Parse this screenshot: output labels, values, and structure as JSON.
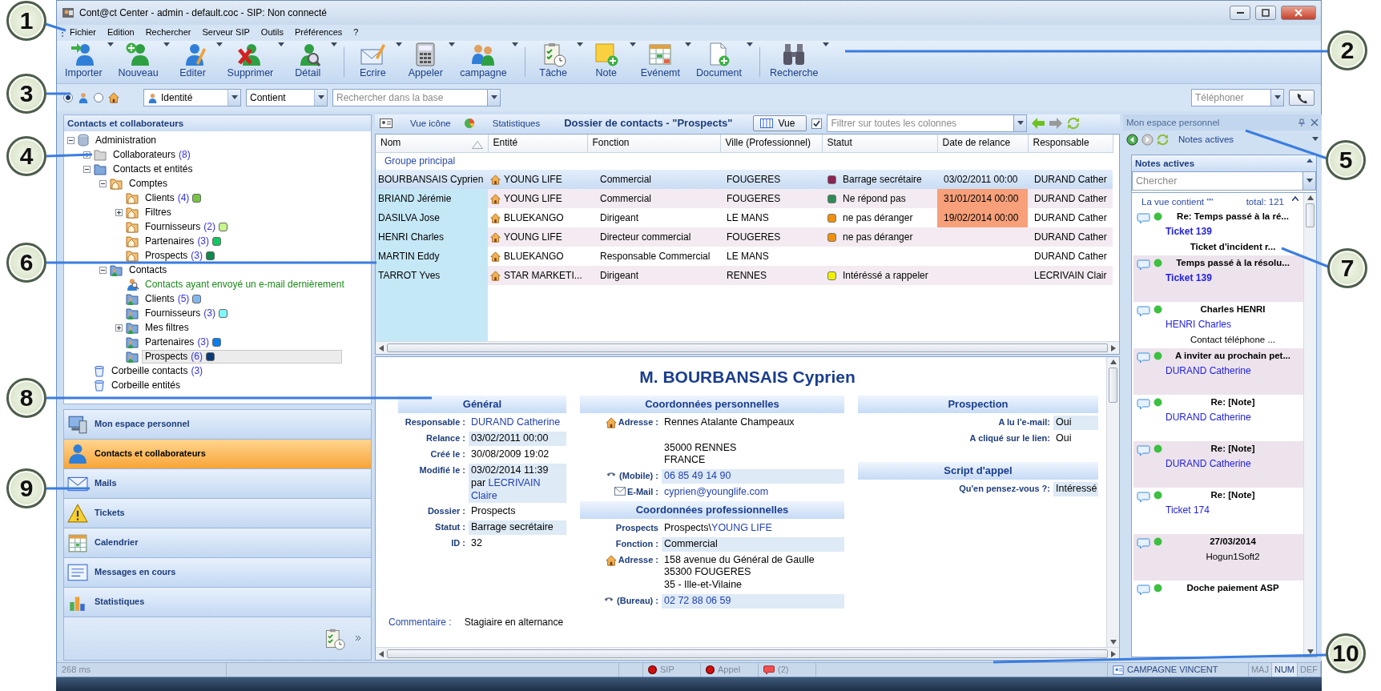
{
  "window": {
    "title": "Cont@ct Center - admin - default.coc - SIP: Non connecté"
  },
  "menu": [
    "Fichier",
    "Edition",
    "Rechercher",
    "Serveur SIP",
    "Outils",
    "Préférences",
    "?"
  ],
  "toolbar": [
    {
      "kind": "button",
      "label": "Importer"
    },
    {
      "kind": "button",
      "label": "Nouveau"
    },
    {
      "kind": "button",
      "label": "Editer"
    },
    {
      "kind": "button",
      "label": "Supprimer"
    },
    {
      "kind": "button",
      "label": "Détail"
    },
    {
      "kind": "separator"
    },
    {
      "kind": "button",
      "label": "Ecrire"
    },
    {
      "kind": "button",
      "label": "Appeler"
    },
    {
      "kind": "button",
      "label": "campagne"
    },
    {
      "kind": "separator"
    },
    {
      "kind": "button",
      "label": "Tâche"
    },
    {
      "kind": "button",
      "label": "Note"
    },
    {
      "kind": "button",
      "label": "Evénemt"
    },
    {
      "kind": "button",
      "label": "Document"
    },
    {
      "kind": "separator"
    },
    {
      "kind": "button",
      "label": "Recherche"
    }
  ],
  "search_bar": {
    "modes": [
      {
        "selected": true
      },
      {
        "selected": false
      }
    ],
    "field": "Identité",
    "operator": "Contient",
    "query": {
      "placeholder": "Rechercher dans la base"
    },
    "phone": {
      "placeholder": "Téléphoner"
    }
  },
  "left_panel": {
    "title": "Contacts et collaborateurs",
    "tree": [
      {
        "label": "Administration",
        "kind": "database",
        "expanded": true,
        "selected": false,
        "children": [
          {
            "label": "Collaborateurs",
            "count": "(8)",
            "kind": "grey-folder",
            "expanded": false,
            "selected": false
          },
          {
            "label": "Contacts et entités",
            "kind": "blue-folder",
            "expanded": true,
            "selected": false,
            "children": [
              {
                "label": "Comptes",
                "kind": "account-folder",
                "expanded": true,
                "selected": false,
                "children": [
                  {
                    "label": "Clients",
                    "count": "(4)",
                    "color": "#76c442",
                    "kind": "account-folder",
                    "selected": false
                  },
                  {
                    "label": "Filtres",
                    "kind": "account-folder",
                    "expanded": false,
                    "selected": false
                  },
                  {
                    "label": "Fournisseurs",
                    "count": "(2)",
                    "color": "#c8f58c",
                    "kind": "account-folder",
                    "selected": false
                  },
                  {
                    "label": "Partenaires",
                    "count": "(3)",
                    "color": "#10c860",
                    "kind": "account-folder",
                    "selected": false
                  },
                  {
                    "label": "Prospects",
                    "count": "(3)",
                    "color": "#0e8a4a",
                    "kind": "account-folder",
                    "selected": false
                  }
                ]
              },
              {
                "label": "Contacts",
                "kind": "contact-folder",
                "expanded": true,
                "selected": false,
                "children": [
                  {
                    "label": "Contacts ayant envoyé un e-mail dernièrement",
                    "kind": "search",
                    "selected": false
                  },
                  {
                    "label": "Clients",
                    "count": "(5)",
                    "color": "#80b8f0",
                    "kind": "contact-folder",
                    "selected": false
                  },
                  {
                    "label": "Fournisseurs",
                    "count": "(3)",
                    "color": "#80f8f8",
                    "kind": "contact-folder",
                    "selected": false
                  },
                  {
                    "label": "Mes filtres",
                    "kind": "contact-folder",
                    "expanded": false,
                    "selected": false
                  },
                  {
                    "label": "Partenaires",
                    "count": "(3)",
                    "color": "#0a80f0",
                    "kind": "contact-folder",
                    "selected": false
                  },
                  {
                    "label": "Prospects",
                    "count": "(6)",
                    "color": "#0a3a78",
                    "kind": "contact-folder",
                    "selected": true
                  }
                ]
              }
            ]
          },
          {
            "label": "Corbeille contacts",
            "count": "(3)",
            "kind": "bin",
            "selected": false
          },
          {
            "label": "Corbeille entités",
            "kind": "bin",
            "selected": false
          }
        ]
      }
    ]
  },
  "nav": [
    {
      "label": "Mon espace personnel",
      "selected": false
    },
    {
      "label": "Contacts et collaborateurs",
      "selected": true
    },
    {
      "label": "Mails",
      "selected": false
    },
    {
      "label": "Tickets",
      "selected": false
    },
    {
      "label": "Calendrier",
      "selected": false
    },
    {
      "label": "Messages en cours",
      "selected": false
    },
    {
      "label": "Statistiques",
      "selected": false
    }
  ],
  "center": {
    "header": {
      "icon_view": "Vue icône",
      "stats": "Statistiques",
      "title": "Dossier de contacts - \"Prospects\"",
      "view_button": "Vue",
      "filter": {
        "checked": true,
        "placeholder": "Filtrer sur toutes les colonnes"
      }
    },
    "table": {
      "columns": [
        "Nom",
        "Entité",
        "Fonction",
        "Ville (Professionnel)",
        "Statut",
        "Date de relance",
        "Responsable"
      ],
      "group": "Groupe principal",
      "rows": [
        {
          "nom": "BOURBANSAIS Cyprien",
          "entite": "YOUNG LIFE",
          "fonction": "Commercial",
          "ville": "FOUGERES",
          "statut": {
            "text": "Barrage secrétaire",
            "color": "#8b2252"
          },
          "relance": {
            "text": "03/02/2011 00:00",
            "overdue": false
          },
          "responsable": "DURAND Cather",
          "selected": true
        },
        {
          "nom": "BRIAND Jérémie",
          "entite": "YOUNG LIFE",
          "fonction": "Commercial",
          "ville": "FOUGERES",
          "statut": {
            "text": "Ne répond pas",
            "color": "#2e8b57"
          },
          "relance": {
            "text": "31/01/2014 00:00",
            "overdue": true
          },
          "responsable": "DURAND Cather",
          "selected": false
        },
        {
          "nom": "DASILVA Jose",
          "entite": "BLUEKANGO",
          "fonction": "Dirigeant",
          "ville": "LE MANS",
          "statut": {
            "text": "ne pas déranger",
            "color": "#f0900a"
          },
          "relance": {
            "text": "19/02/2014 00:00",
            "overdue": true
          },
          "responsable": "DURAND Cather",
          "selected": false
        },
        {
          "nom": "HENRI Charles",
          "entite": "YOUNG LIFE",
          "fonction": "Directeur commercial",
          "ville": "FOUGERES",
          "statut": {
            "text": "ne pas déranger",
            "color": "#f0900a"
          },
          "responsable": "DURAND Cather",
          "selected": false
        },
        {
          "nom": "MARTIN Eddy",
          "entite": "BLUEKANGO",
          "fonction": "Responsable Commercial",
          "ville": "LE MANS",
          "responsable": "DURAND Cather",
          "selected": false
        },
        {
          "nom": "TARROT Yves",
          "entite": "STAR MARKETI...",
          "fonction": "Dirigeant",
          "ville": "RENNES",
          "statut": {
            "text": "Intéréssé a rappeler",
            "color": "#f0f000"
          },
          "responsable": "LECRIVAIN Clair",
          "selected": false
        }
      ]
    },
    "detail": {
      "title": "M. BOURBANSAIS Cyprien",
      "columns": [
        [
          {
            "heading": "Général",
            "fields": [
              {
                "label": "Responsable :",
                "kind": "plain",
                "shaded": false,
                "parts": [
                  {
                    "text": "DURAND Catherine",
                    "link": true
                  }
                ]
              },
              {
                "label": "Relance :",
                "kind": "plain",
                "shaded": true,
                "parts": [
                  {
                    "text": "03/02/2011 00:00",
                    "link": false
                  }
                ]
              },
              {
                "label": "Créé le :",
                "kind": "plain",
                "shaded": false,
                "parts": [
                  {
                    "text": "30/08/2009 19:02",
                    "link": false
                  }
                ]
              },
              {
                "label": "Modifié le :",
                "kind": "plain",
                "shaded": true,
                "parts": [
                  {
                    "text": "03/02/2014 11:39 par ",
                    "link": false
                  },
                  {
                    "text": "LECRIVAIN Claire",
                    "link": true
                  }
                ]
              },
              {
                "label": "Dossier :",
                "kind": "plain",
                "shaded": false,
                "parts": [
                  {
                    "text": "Prospects",
                    "link": false
                  }
                ]
              },
              {
                "label": "Statut :",
                "kind": "plain",
                "shaded": true,
                "parts": [
                  {
                    "text": "Barrage secrétaire",
                    "link": false
                  }
                ]
              },
              {
                "label": "ID :",
                "kind": "plain",
                "shaded": false,
                "parts": [
                  {
                    "text": "32",
                    "link": false
                  }
                ]
              }
            ]
          }
        ],
        [
          {
            "heading": "Coordonnées personnelles",
            "fields": [
              {
                "label": "Adresse :",
                "kind": "address",
                "shaded": false,
                "parts": [
                  {
                    "text": "Rennes Atalante Champeaux\n\n35000 RENNES\nFRANCE",
                    "link": false
                  }
                ]
              },
              {
                "label": "(Mobile) :",
                "kind": "phone",
                "shaded": true,
                "parts": [
                  {
                    "text": "06 85 49 14 90",
                    "link": true
                  }
                ]
              },
              {
                "label": "E-Mail :",
                "kind": "email",
                "shaded": false,
                "parts": [
                  {
                    "text": "cyprien@younglife.com",
                    "link": true
                  }
                ]
              }
            ]
          },
          {
            "heading": "Coordonnées professionnelles",
            "fields": [
              {
                "label": "Prospects",
                "kind": "plain",
                "shaded": false,
                "parts": [
                  {
                    "text": "Prospects\\",
                    "link": false
                  },
                  {
                    "text": "YOUNG LIFE",
                    "link": true
                  }
                ]
              },
              {
                "label": "Fonction :",
                "kind": "plain",
                "shaded": true,
                "parts": [
                  {
                    "text": "Commercial",
                    "link": false
                  }
                ]
              },
              {
                "label": "Adresse :",
                "kind": "address",
                "shaded": false,
                "parts": [
                  {
                    "text": "158 avenue du Général de Gaulle\n35300 FOUGERES\n35 - Ille-et-Vilaine",
                    "link": false
                  }
                ]
              },
              {
                "label": "(Bureau) :",
                "kind": "phone",
                "shaded": true,
                "parts": [
                  {
                    "text": "02 72 88 06 59",
                    "link": true
                  }
                ]
              }
            ]
          }
        ],
        [
          {
            "heading": "Prospection",
            "fields": [
              {
                "label": "A lu l'e-mail:",
                "kind": "plain",
                "shaded": true,
                "parts": [
                  {
                    "text": "Oui",
                    "link": false
                  }
                ]
              },
              {
                "label": "A cliqué sur le lien:",
                "kind": "plain",
                "shaded": false,
                "parts": [
                  {
                    "text": "Oui",
                    "link": false
                  }
                ]
              }
            ]
          },
          {
            "heading": "Script d'appel",
            "fields": [
              {
                "label": "Qu'en pensez-vous ?:",
                "kind": "plain",
                "shaded": true,
                "parts": [
                  {
                    "text": "Intéressé",
                    "link": false
                  }
                ]
              }
            ]
          }
        ]
      ],
      "comment": {
        "label": "Commentaire :",
        "value": "Stagiaire en alternance"
      }
    }
  },
  "right_panel": {
    "title": "Mon espace personnel",
    "toolbar_label": "Notes actives",
    "box_title": "Notes actives",
    "search": {
      "placeholder": "Chercher"
    },
    "view_label": "La vue contient \"\"",
    "total": "total: 121",
    "notes": [
      {
        "kind": "ticket",
        "title": "Re: Temps passé à la ré...",
        "link": "Ticket 139",
        "extra": "Ticket d'incident r...",
        "shaded": false
      },
      {
        "kind": "ticket",
        "title": "Temps passé à la résolu...",
        "link": "Ticket 139",
        "shaded": true
      },
      {
        "kind": "note",
        "title": "Charles HENRI",
        "link": "HENRI Charles",
        "extra": "Contact téléphone ...",
        "shaded": false
      },
      {
        "kind": "note",
        "title": "A inviter au prochain pet...",
        "link": "DURAND Catherine",
        "shaded": true
      },
      {
        "kind": "note",
        "title": "Re: [Note]",
        "link": "DURAND Catherine",
        "shaded": false
      },
      {
        "kind": "note",
        "title": "Re: [Note]",
        "link": "DURAND Catherine",
        "shaded": true
      },
      {
        "kind": "note",
        "title": "Re: [Note]",
        "link": "Ticket 174",
        "shaded": false
      },
      {
        "kind": "note",
        "title": "27/03/2014",
        "extra": "Hogun1Soft2",
        "shaded": true
      },
      {
        "kind": "note",
        "title": "Doche paiement ASP",
        "shaded": false
      }
    ]
  },
  "status_bar": {
    "timing": "268 ms",
    "indicators": [
      {
        "kind": "dot",
        "label": "SIP"
      },
      {
        "kind": "dot",
        "label": "Appel"
      },
      {
        "kind": "messages",
        "label": "(2)"
      }
    ],
    "campaign": "CAMPAGNE VINCENT",
    "keys": [
      {
        "label": "MAJ",
        "on": false
      },
      {
        "label": "NUM",
        "on": true
      },
      {
        "label": "DEF",
        "on": false
      }
    ]
  },
  "callouts": [
    {
      "number": "1"
    },
    {
      "number": "2"
    },
    {
      "number": "3"
    },
    {
      "number": "4"
    },
    {
      "number": "5"
    },
    {
      "number": "6"
    },
    {
      "number": "7"
    },
    {
      "number": "8"
    },
    {
      "number": "9"
    },
    {
      "number": "10"
    }
  ]
}
